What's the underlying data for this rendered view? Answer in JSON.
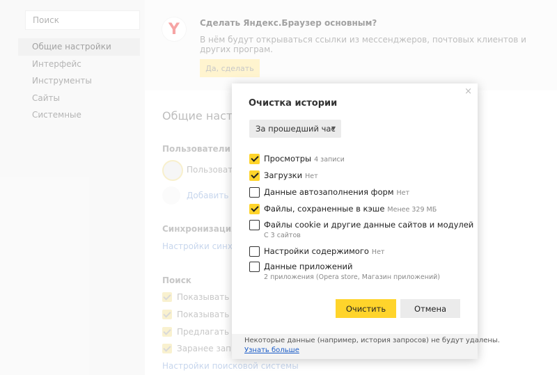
{
  "sidebar": {
    "search_placeholder": "Поиск",
    "items": [
      {
        "label": "Общие настройки",
        "active": true
      },
      {
        "label": "Интерфейс"
      },
      {
        "label": "Инструменты"
      },
      {
        "label": "Сайты"
      },
      {
        "label": "Системные"
      }
    ]
  },
  "promo": {
    "logo_letter": "Y",
    "title": "Сделать Яндекс.Браузер основным?",
    "text": "В нём будут открываться ссылки из мессенджеров, почтовых клиентов и других програм.",
    "button": "Да, сделать"
  },
  "main": {
    "heading": "Общие настро",
    "users": {
      "title": "Пользователи",
      "user_label": "Пользовател",
      "add_label": "Добавить пол"
    },
    "sync": {
      "title": "Синхронизация",
      "link": "Настройки синхрон"
    },
    "search": {
      "title": "Поиск",
      "options": [
        "Показывать по",
        "Показывать в У",
        "Предлагать исп",
        "Заранее запра"
      ],
      "link": "Настройки поисковой системы"
    }
  },
  "dialog": {
    "close_glyph": "×",
    "title": "Очистка истории",
    "period": "За прошедший час",
    "items": [
      {
        "label": "Просмотры",
        "note": "4 записи",
        "checked": true
      },
      {
        "label": "Загрузки",
        "note": "Нет",
        "checked": true
      },
      {
        "label": "Данные автозаполнения форм",
        "note": "Нет",
        "checked": false
      },
      {
        "label": "Файлы, сохраненные в кэше",
        "note": "Менее 329 МБ",
        "checked": true
      },
      {
        "label": "Файлы cookie и другие данные сайтов и модулей",
        "sub": "С 3 сайтов",
        "checked": false
      },
      {
        "label": "Настройки содержимого",
        "note": "Нет",
        "checked": false
      },
      {
        "label": "Данные приложений",
        "sub": "2 приложения (Opera store, Магазин приложений)",
        "checked": false
      }
    ],
    "clear_button": "Очистить",
    "cancel_button": "Отмена",
    "footer_note": "Некоторые данные (например, история запросов) не будут удалены.",
    "footer_link": "Узнать больше"
  },
  "colors": {
    "accent": "#ffd42b",
    "link": "#1a5cc8"
  }
}
